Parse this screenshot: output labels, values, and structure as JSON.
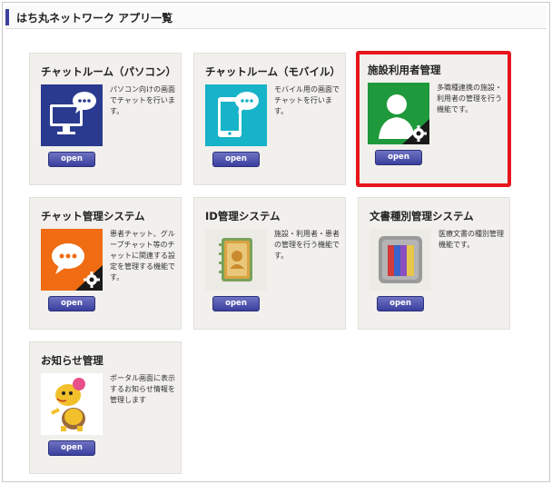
{
  "header": {
    "title": "はち丸ネットワーク アプリ一覧"
  },
  "apps": [
    {
      "title": "チャットルーム（パソコン）",
      "description": "パソコン向けの画面でチャットを行います。",
      "open_label": "open",
      "icon": "pc-chat-icon",
      "icon_color": "#2a3a8f"
    },
    {
      "title": "チャットルーム（モバイル）",
      "description": "モバイル用の画面でチャットを行います。",
      "open_label": "open",
      "icon": "mobile-chat-icon",
      "icon_color": "#17b3c8"
    },
    {
      "title": "施設利用者管理",
      "description": "多職種連携の施設・利用者の管理を行う機能です。",
      "open_label": "open",
      "icon": "user-settings-icon",
      "icon_color": "#1e9a3c",
      "selected": true,
      "highlight_color": "#e8161c"
    },
    {
      "title": "チャット管理システム",
      "description": "患者チャット、グループチャット等のチャットに関連する設定を管理する機能です。",
      "open_label": "open",
      "icon": "chat-settings-icon",
      "icon_color": "#ef6c12"
    },
    {
      "title": "ID管理システム",
      "description": "施設・利用者・患者の管理を行う機能です。",
      "open_label": "open",
      "icon": "address-book-icon",
      "icon_color": "#7aa25a"
    },
    {
      "title": "文書種別管理システム",
      "description": "医療文書の種別管理機能です。",
      "open_label": "open",
      "icon": "binders-icon",
      "icon_color": "#8a8a8a"
    },
    {
      "title": "お知らせ管理",
      "description": "ポータル画面に表示するお知らせ情報を管理します",
      "open_label": "open",
      "icon": "mascot-icon",
      "icon_color": "#f2c02a"
    }
  ],
  "colors": {
    "button": "#3a3f9e",
    "card_bg": "#f1f0ec",
    "header_accent": "#3a3f9e"
  }
}
